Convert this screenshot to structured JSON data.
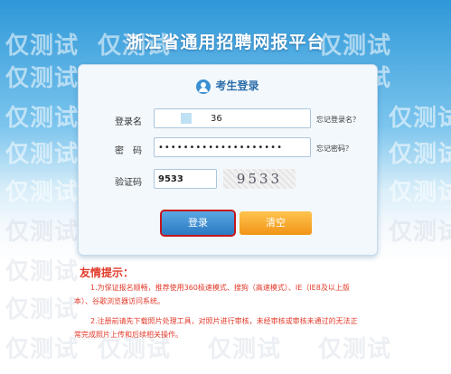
{
  "watermark": "仅测试",
  "header": {
    "title": "浙江省通用招聘网报平台"
  },
  "login": {
    "heading": "考生登录",
    "username": {
      "label": "登录名",
      "value": "36",
      "side_link": "忘记登录名？"
    },
    "password": {
      "label": "密　码",
      "value": "••••••••••••••••••••",
      "side_link": "忘记密码？"
    },
    "captcha": {
      "label": "验证码",
      "value": "9533",
      "image_text": "9533"
    },
    "login_button": "登录",
    "reset_button": "清空"
  },
  "tips": {
    "title": "友情提示：",
    "line1": "1.为保证报名顺畅，推荐使用360极速模式、搜狗（高速模式）、IE（IE8及以上版",
    "line2": "本）、谷歌浏览器访问系统。",
    "line3": "2.注册前请先下载照片处理工具，对照片进行审核，未经审核或审核未通过的无法正",
    "line4": "常完成照片上传和后续相关操作。"
  },
  "colors": {
    "primary": "#2b79c2",
    "reset": "#f09418",
    "tips": "#e23a2a",
    "highlight": "#c4161c"
  }
}
